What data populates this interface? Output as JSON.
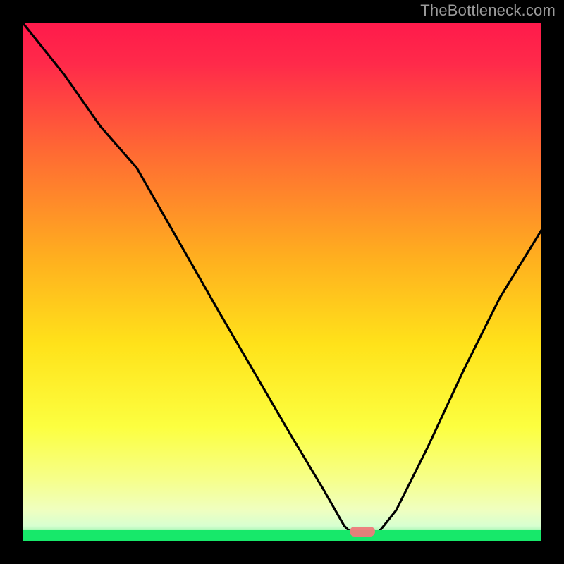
{
  "watermark": "TheBottleneck.com",
  "colors": {
    "bg_black": "#000000",
    "gradient_top": "#ff1a4b",
    "gradient_mid1": "#ff7a2a",
    "gradient_mid2": "#ffd31a",
    "gradient_low": "#f8ff66",
    "gradient_pale": "#e8ffb0",
    "green": "#17e86a",
    "curve": "#000000",
    "marker": "#ee7b7b",
    "watermark": "#9a9a9a"
  },
  "chart_data": {
    "type": "line",
    "title": "",
    "xlabel": "",
    "ylabel": "",
    "xlim": [
      0,
      100
    ],
    "ylim": [
      0,
      100
    ],
    "grid": false,
    "legend": false,
    "background": "vertical red→yellow→pale-yellow gradient with thin green strip at bottom",
    "series": [
      {
        "name": "bottleneck-curve",
        "x": [
          0,
          8,
          15,
          22,
          30,
          38,
          45,
          52,
          58,
          62,
          64,
          66,
          68,
          72,
          78,
          85,
          92,
          100
        ],
        "values": [
          100,
          90,
          80,
          72,
          58,
          44,
          32,
          20,
          10,
          3,
          1,
          0,
          1,
          6,
          18,
          33,
          47,
          60
        ]
      }
    ],
    "marker": {
      "x_start": 63,
      "x_end": 68,
      "y": 0
    },
    "green_strip_height_pct": 2.2
  }
}
